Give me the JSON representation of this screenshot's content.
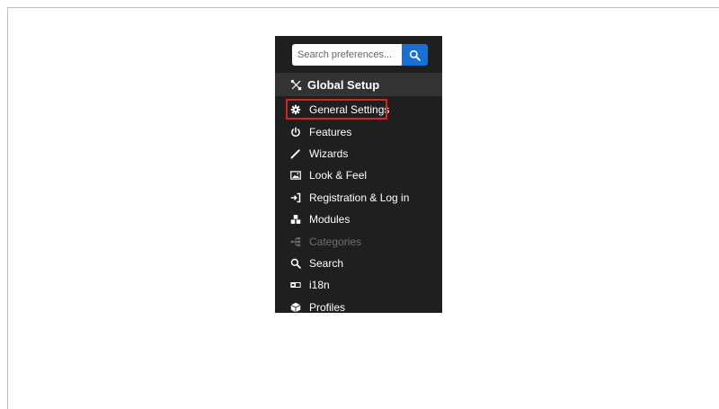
{
  "search": {
    "placeholder": "Search preferences...",
    "button_icon": "search-icon"
  },
  "header": {
    "title": "Global Setup",
    "icon": "tools-icon"
  },
  "menu": {
    "items": [
      {
        "label": "General Settings",
        "icon": "gear-icon",
        "highlighted": true
      },
      {
        "label": "Features",
        "icon": "power-icon"
      },
      {
        "label": "Wizards",
        "icon": "wand-icon"
      },
      {
        "label": "Look & Feel",
        "icon": "image-icon"
      },
      {
        "label": "Registration & Log in",
        "icon": "sign-in-icon"
      },
      {
        "label": "Modules",
        "icon": "cubes-icon"
      },
      {
        "label": "Categories",
        "icon": "sitemap-icon",
        "disabled": true
      },
      {
        "label": "Search",
        "icon": "search-icon"
      },
      {
        "label": "i18n",
        "icon": "language-icon"
      },
      {
        "label": "Profiles",
        "icon": "cube-icon"
      }
    ]
  },
  "colors": {
    "panel_bg": "#1f1f1f",
    "header_bg": "#333333",
    "search_button": "#1a6fd6",
    "highlight_border": "#d62228",
    "disabled_text": "#6f6f6f"
  }
}
